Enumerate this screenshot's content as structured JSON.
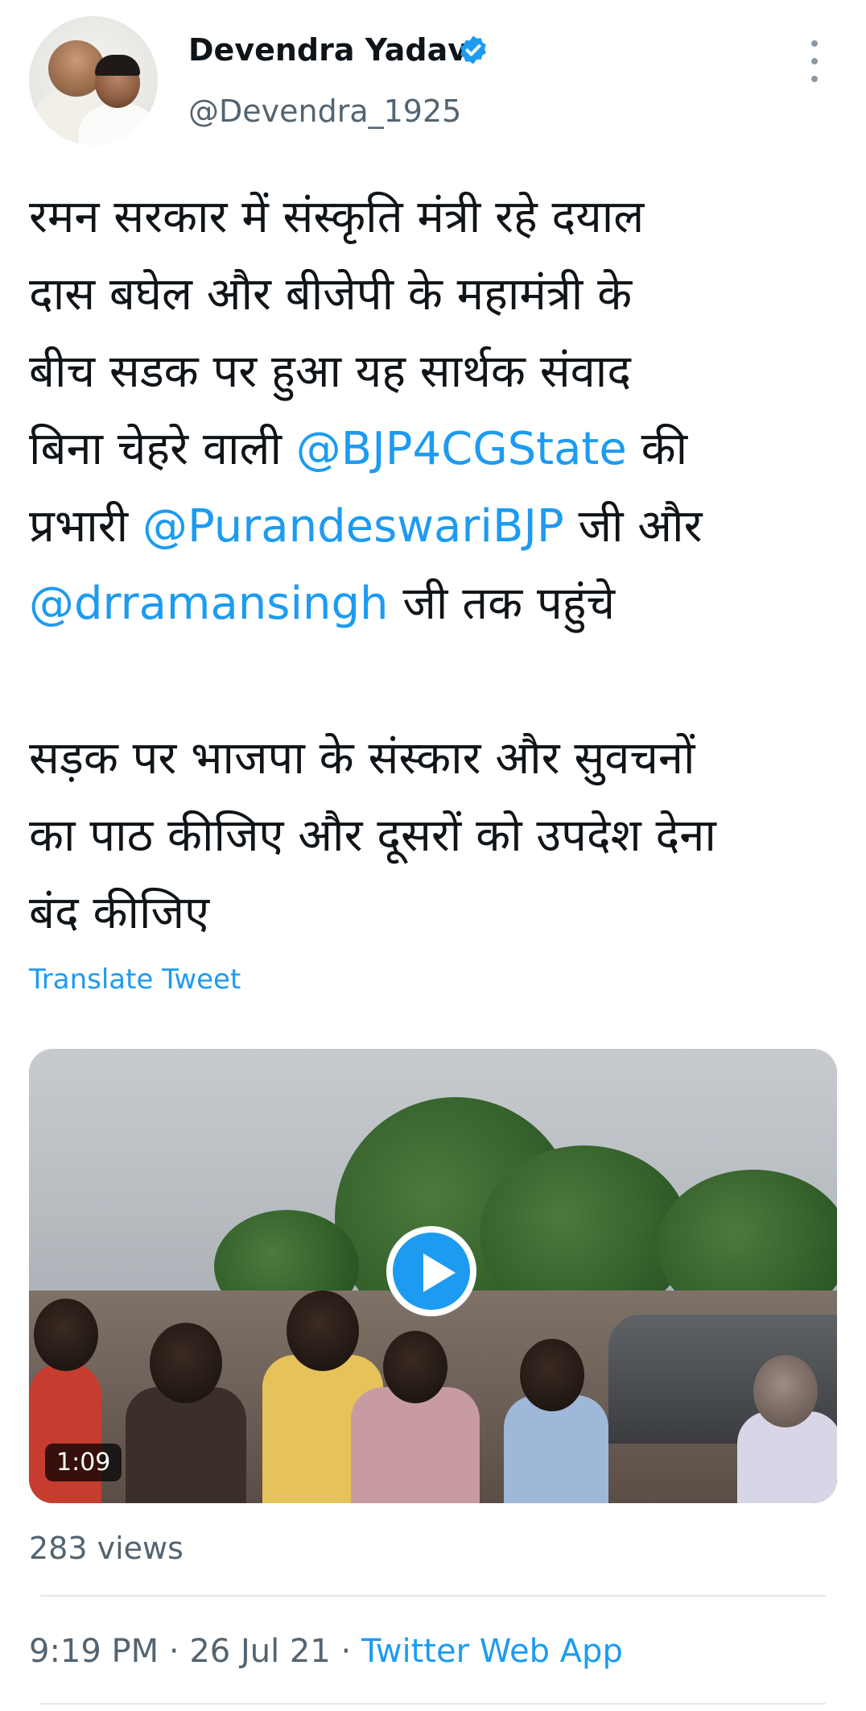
{
  "author": {
    "name": "Devendra Yadav",
    "handle": "@Devendra_1925",
    "verified": true,
    "verified_icon": "verified-badge-icon",
    "avatar_icon": "profile-photo"
  },
  "tweet": {
    "lines": [
      [
        {
          "t": "रमन सरकार में संस्कृति मंत्री रहे दयाल"
        }
      ],
      [
        {
          "t": "दास बघेल और बीजेपी के महामंत्री के"
        }
      ],
      [
        {
          "t": "बीच सडक पर हुआ यह सार्थक संवाद"
        }
      ],
      [
        {
          "t": "बिना चेहरे वाली "
        },
        {
          "m": "@BJP4CGState"
        },
        {
          "t": " की"
        }
      ],
      [
        {
          "t": "प्रभारी "
        },
        {
          "m": "@PurandeswariBJP"
        },
        {
          "t": "  जी और"
        }
      ],
      [
        {
          "m": "@drramansingh"
        },
        {
          "t": " जी तक पहुंचे"
        }
      ],
      [],
      [
        {
          "t": "सड़क पर भाजपा के संस्कार और सुवचनों"
        }
      ],
      [
        {
          "t": "का पाठ कीजिए और दूसरों को उपदेश देना"
        }
      ],
      [
        {
          "t": "बंद कीजिए"
        }
      ]
    ],
    "translate_label": "Translate Tweet"
  },
  "media": {
    "duration": "1:09",
    "play_icon": "play-icon"
  },
  "stats": {
    "views": "283 views"
  },
  "meta": {
    "time": "9:19 PM",
    "separator1": " · ",
    "date": "26 Jul 21",
    "separator2": " · ",
    "source": "Twitter Web App"
  },
  "colors": {
    "accent": "#1d9bf0",
    "secondary_text": "#536471",
    "primary_text": "#0f1419"
  }
}
